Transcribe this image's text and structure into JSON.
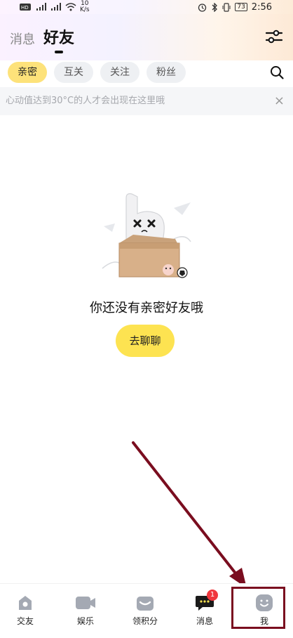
{
  "status_bar": {
    "net_speed_value": "10",
    "net_speed_unit": "K/s",
    "battery": "73",
    "time": "2:56",
    "icons": [
      "hd-icon",
      "signal-icon",
      "wifi-icon",
      "alarm-icon",
      "bluetooth-icon",
      "vibrate-icon",
      "battery-icon"
    ]
  },
  "header": {
    "tab_messages": "消息",
    "tab_friends": "好友",
    "filter_icon": "sliders-icon"
  },
  "chips": [
    {
      "label": "亲密",
      "active": true
    },
    {
      "label": "互关",
      "active": false
    },
    {
      "label": "关注",
      "active": false
    },
    {
      "label": "粉丝",
      "active": false
    }
  ],
  "notice": {
    "text": "心动值达到30°C的人才会出现在这里哦",
    "close": "×"
  },
  "empty_state": {
    "message": "你还没有亲密好友哦",
    "button": "去聊聊"
  },
  "bottom_nav": [
    {
      "label": "交友",
      "icon": "home-icon"
    },
    {
      "label": "娱乐",
      "icon": "video-icon"
    },
    {
      "label": "领积分",
      "icon": "gift-box-icon"
    },
    {
      "label": "消息",
      "icon": "chat-icon",
      "badge": "1"
    },
    {
      "label": "我",
      "icon": "smiley-icon"
    }
  ],
  "colors": {
    "accent_yellow": "#fde351",
    "chip_active": "#fde27a",
    "badge_red": "#f0373d",
    "annotation": "#7a0d1f"
  }
}
